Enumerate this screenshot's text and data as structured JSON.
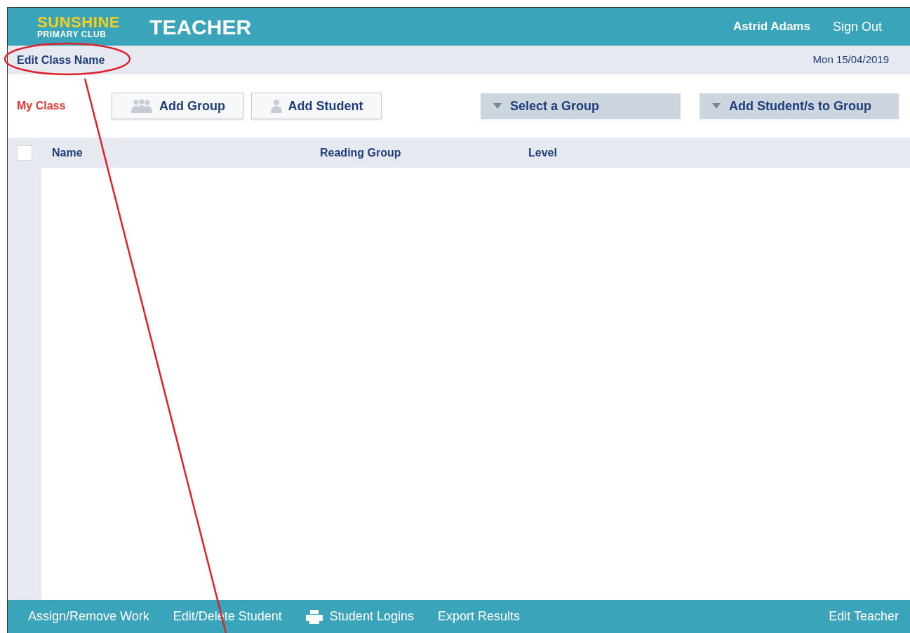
{
  "header": {
    "logo_top": "SUNSHINE",
    "logo_bottom": "PRIMARY CLUB",
    "title": "TEACHER",
    "user": "Astrid Adams",
    "sign_out": "Sign Out"
  },
  "subheader": {
    "edit_class_name": "Edit Class Name",
    "date": "Mon 15/04/2019"
  },
  "toolbar": {
    "class_label": "My Class",
    "buttons": [
      {
        "kind": "group",
        "label": "Add Group"
      },
      {
        "kind": "student",
        "label": "Add Student"
      }
    ],
    "dropdowns": [
      {
        "label": "Select a Group"
      },
      {
        "label": "Add Student/s to Group"
      }
    ]
  },
  "table": {
    "select_all_checked": false,
    "columns": [
      "Name",
      "Reading Group",
      "Level"
    ]
  },
  "footer": {
    "links": [
      {
        "kind": "text",
        "label": "Assign/Remove Work"
      },
      {
        "kind": "text",
        "label": "Edit/Delete Student"
      },
      {
        "kind": "print",
        "label": "Student Logins"
      },
      {
        "kind": "text",
        "label": "Export Results"
      }
    ],
    "right": "Edit Teacher"
  }
}
